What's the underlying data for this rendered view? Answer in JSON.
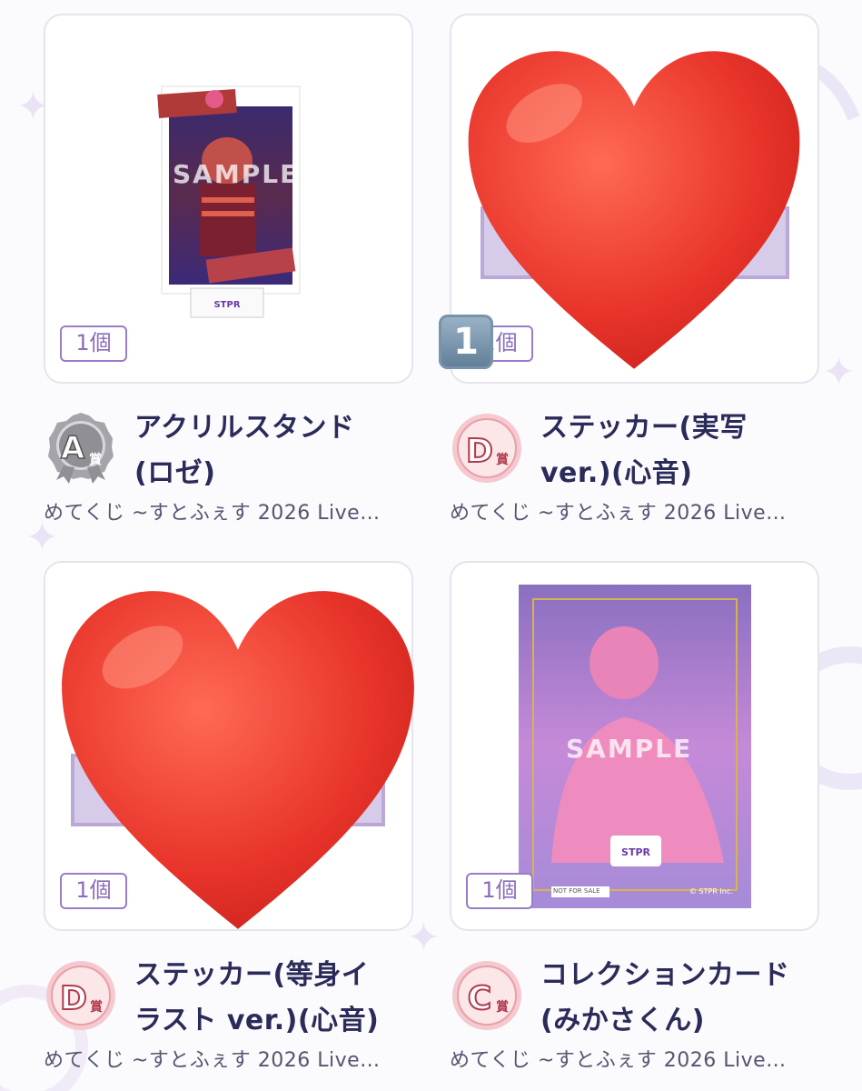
{
  "items": [
    {
      "quantity": "1個",
      "prize": "A",
      "prize_suffix": "賞",
      "title_line1": "アクリルスタンド",
      "title_line2": "(ロゼ)",
      "subtitle": "めてくじ ~すとふぇす 2026 Live…",
      "image_kind": "acrylic-stand",
      "sample_text": "SAMPLE"
    },
    {
      "quantity": "1個",
      "prize": "D",
      "prize_suffix": "賞",
      "title_line1": "ステッカー(実写",
      "title_line2": "ver.)(心音)",
      "subtitle": "めてくじ ~すとふぇす 2026 Live…",
      "image_kind": "sticker-covered-by-heart",
      "overlay_emoji": "keycap-1",
      "overlay_emoji_text": "1"
    },
    {
      "quantity": "1個",
      "prize": "D",
      "prize_suffix": "賞",
      "title_line1": "ステッカー(等身イ",
      "title_line2": "ラスト ver.)(心音)",
      "subtitle": "めてくじ ~すとふぇす 2026 Live…",
      "image_kind": "sticker-covered-by-heart"
    },
    {
      "quantity": "1個",
      "prize": "C",
      "prize_suffix": "賞",
      "title_line1": "コレクションカード",
      "title_line2": "(みかさくん)",
      "subtitle": "めてくじ ~すとふぇす 2026 Live…",
      "image_kind": "collection-card",
      "sample_text": "SAMPLE",
      "card_footer_left": "NOT FOR SALE",
      "card_footer_right": "© STPR Inc."
    }
  ],
  "colors": {
    "accent_purple": "#9a7cc7",
    "heart_red": "#e8342a",
    "badge_silver": "#8f8f95",
    "badge_d": "#b23a4e",
    "badge_c": "#b23a4e"
  }
}
